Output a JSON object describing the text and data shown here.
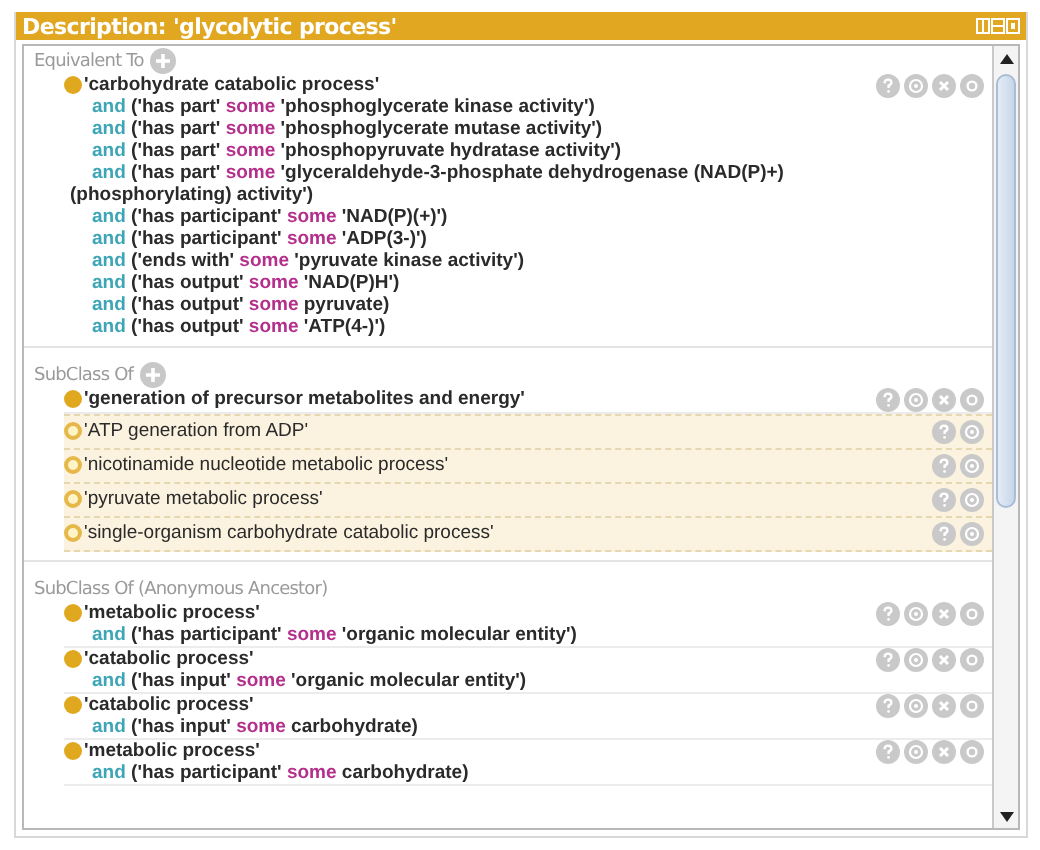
{
  "panel": {
    "title": "Description: 'glycolytic process'"
  },
  "sections": [
    {
      "heading": "Equivalent To",
      "can_add": true,
      "items": [
        {
          "inferred": false,
          "label": "'carbohydrate catabolic process'",
          "clauses": [
            {
              "keyword": "and",
              "property": "('has part'",
              "quantifier": "some",
              "filler": "'phosphoglycerate kinase activity')"
            },
            {
              "keyword": "and",
              "property": "('has part'",
              "quantifier": "some",
              "filler": "'phosphoglycerate mutase activity')"
            },
            {
              "keyword": "and",
              "property": "('has part'",
              "quantifier": "some",
              "filler": "'phosphopyruvate hydratase activity')"
            },
            {
              "keyword": "and",
              "property": "('has part'",
              "quantifier": "some",
              "filler": "'glyceraldehyde-3-phosphate dehydrogenase (NAD(P)+) (phosphorylating) activity')"
            },
            {
              "keyword": "and",
              "property": "('has participant'",
              "quantifier": "some",
              "filler": "'NAD(P)(+)')"
            },
            {
              "keyword": "and",
              "property": "('has participant'",
              "quantifier": "some",
              "filler": "'ADP(3-)')"
            },
            {
              "keyword": "and",
              "property": "('ends with'",
              "quantifier": "some",
              "filler": "'pyruvate kinase activity')"
            },
            {
              "keyword": "and",
              "property": "('has output'",
              "quantifier": "some",
              "filler": "'NAD(P)H')"
            },
            {
              "keyword": "and",
              "property": "('has output'",
              "quantifier": "some",
              "filler": "pyruvate)"
            },
            {
              "keyword": "and",
              "property": "('has output'",
              "quantifier": "some",
              "filler": "'ATP(4-)')"
            }
          ]
        }
      ]
    },
    {
      "heading": "SubClass Of",
      "can_add": true,
      "items": [
        {
          "inferred": false,
          "label": "'generation of precursor metabolites and energy'"
        },
        {
          "inferred": true,
          "label": "'ATP generation from ADP'"
        },
        {
          "inferred": true,
          "label": "'nicotinamide nucleotide metabolic process'"
        },
        {
          "inferred": true,
          "label": "'pyruvate metabolic process'"
        },
        {
          "inferred": true,
          "label": "'single-organism carbohydrate catabolic process'"
        }
      ]
    },
    {
      "heading": "SubClass Of (Anonymous Ancestor)",
      "items": [
        {
          "inferred": false,
          "label": "'metabolic process'",
          "clauses": [
            {
              "keyword": "and",
              "property": "('has participant'",
              "quantifier": "some",
              "filler": "'organic molecular entity')"
            }
          ]
        },
        {
          "inferred": false,
          "label": "'catabolic process'",
          "clauses": [
            {
              "keyword": "and",
              "property": "('has input'",
              "quantifier": "some",
              "filler": "'organic molecular entity')"
            }
          ]
        },
        {
          "inferred": false,
          "label": "'catabolic process'",
          "clauses": [
            {
              "keyword": "and",
              "property": "('has input'",
              "quantifier": "some",
              "filler": "carbohydrate)"
            }
          ]
        },
        {
          "inferred": false,
          "label": "'metabolic process'",
          "clauses": [
            {
              "keyword": "and",
              "property": "('has participant'",
              "quantifier": "some",
              "filler": "carbohydrate)"
            }
          ]
        }
      ]
    }
  ]
}
